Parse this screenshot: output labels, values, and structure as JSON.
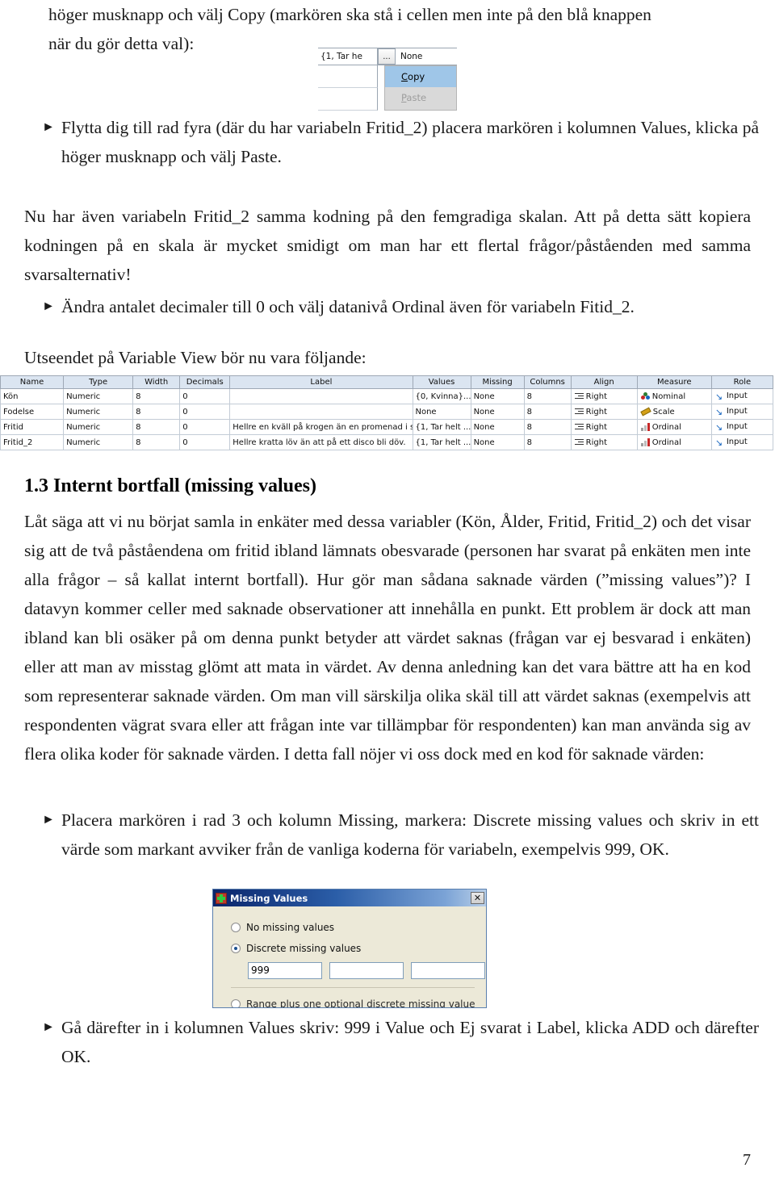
{
  "intro": {
    "line1": "höger musknapp och välj Copy (markören ska stå i cellen men inte på den blå knappen",
    "line2": "när du gör detta val):"
  },
  "context_menu_shot": {
    "cell_value": "{1, Tar he",
    "ellipsis_button": "...",
    "missing_value": "None",
    "items": [
      {
        "label": "Copy",
        "state": "selected"
      },
      {
        "label": "Paste",
        "state": "disabled"
      }
    ]
  },
  "bullets": {
    "b1": "Flytta dig till rad fyra (där du har variabeln Fritid_2) placera markören i kolumnen Values, klicka på höger musknapp och välj Paste.",
    "b2": "Ändra antalet decimaler till 0 och välj datanivå Ordinal även för variabeln Fitid_2.",
    "b3": "Placera markören i rad 3 och kolumn Missing, markera: Discrete missing values och skriv in ett värde som markant avviker från de vanliga koderna för variabeln, exempelvis 999, OK.",
    "b4": "Gå därefter in i kolumnen Values skriv: 999 i Value och Ej svarat i Label, klicka ADD och därefter OK.",
    "marker": "►"
  },
  "paragraphs": {
    "p1": "Nu har även variabeln Fritid_2 samma kodning på den femgradiga skalan. Att på detta sätt kopiera kodningen på en skala är mycket smidigt om man har ett flertal frågor/påståenden med samma svarsalternativ!",
    "p2": "Utseendet på Variable View bör nu vara följande:",
    "p3": "Låt säga att vi nu börjat samla in enkäter med dessa variabler (Kön, Ålder, Fritid, Fritid_2) och det visar sig att de två påståendena om fritid ibland lämnats obesvarade (personen har svarat på enkäten men inte alla frågor – så kallat internt bortfall). Hur gör man sådana saknade värden (”missing values”)? I datavyn kommer celler med saknade observationer att innehålla en punkt. Ett problem är dock att man ibland kan bli osäker på om denna punkt betyder att värdet saknas (frågan var ej besvarad i enkäten) eller att man av misstag glömt att mata in värdet. Av denna anledning kan det vara bättre att ha en kod som representerar saknade värden. Om man vill särskilja olika skäl till att värdet saknas (exempelvis att respondenten vägrat svara eller att frågan inte var tillämpbar för respondenten) kan man använda sig av flera olika koder för saknade värden. I detta fall nöjer vi oss dock med en kod för saknade värden:"
  },
  "section_heading": "1.3 Internt bortfall (missing values)",
  "variable_view": {
    "columns": [
      "Name",
      "Type",
      "Width",
      "Decimals",
      "Label",
      "Values",
      "Missing",
      "Columns",
      "Align",
      "Measure",
      "Role"
    ],
    "rows": [
      {
        "name": "Kön",
        "type": "Numeric",
        "width": "8",
        "decimals": "0",
        "label": "",
        "values": "{0, Kvinna}...",
        "missing": "None",
        "cols": "8",
        "align": "Right",
        "align_icon": "align-icon",
        "measure": "Nominal",
        "measure_icon": "nominal-icon",
        "role": "Input",
        "role_icon": "input-arrow-icon"
      },
      {
        "name": "Fodelse",
        "type": "Numeric",
        "width": "8",
        "decimals": "0",
        "label": "",
        "values": "None",
        "missing": "None",
        "cols": "8",
        "align": "Right",
        "align_icon": "align-icon",
        "measure": "Scale",
        "measure_icon": "scale-ruler-icon",
        "role": "Input",
        "role_icon": "input-arrow-icon"
      },
      {
        "name": "Fritid",
        "type": "Numeric",
        "width": "8",
        "decimals": "0",
        "label": "Hellre en kväll på krogen än en promenad i skogen",
        "values": "{1, Tar helt ...",
        "missing": "None",
        "cols": "8",
        "align": "Right",
        "align_icon": "align-icon",
        "measure": "Ordinal",
        "measure_icon": "ordinal-icon",
        "role": "Input",
        "role_icon": "input-arrow-icon"
      },
      {
        "name": "Fritid_2",
        "type": "Numeric",
        "width": "8",
        "decimals": "0",
        "label": "Hellre kratta löv än att på ett disco bli döv.",
        "values": "{1, Tar helt ...",
        "missing": "None",
        "cols": "8",
        "align": "Right",
        "align_icon": "align-icon",
        "measure": "Ordinal",
        "measure_icon": "ordinal-icon",
        "role": "Input",
        "role_icon": "input-arrow-icon"
      }
    ]
  },
  "missing_values_dialog": {
    "title": "Missing Values",
    "close_label": "✕",
    "options": [
      {
        "label": "No missing values",
        "selected": false
      },
      {
        "label": "Discrete missing values",
        "selected": true
      },
      {
        "label": "Range plus one optional discrete missing value",
        "selected": false
      }
    ],
    "fields": [
      {
        "value": "999"
      },
      {
        "value": ""
      },
      {
        "value": ""
      }
    ]
  },
  "footer": {
    "page_number": "7"
  },
  "colors": {
    "table_header_bg": "#dbe5f1",
    "menu_selection": "#9fc6e8",
    "dialog_title_start": "#0a246a",
    "dialog_face": "#ece9d8",
    "ordinal_accent": "#c62828",
    "role_accent": "#1565c0"
  }
}
